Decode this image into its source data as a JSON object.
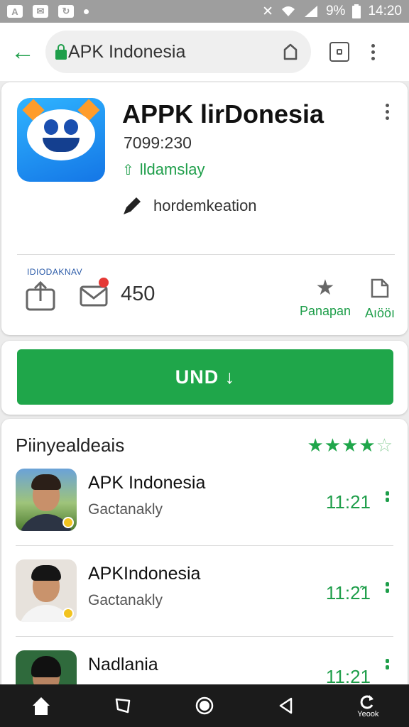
{
  "status_bar": {
    "battery_text": "9%",
    "time": "14:20"
  },
  "browser": {
    "url_text": "APK Indonesia"
  },
  "app": {
    "title": "APPK lirDonesia",
    "code": "7099:230",
    "developer": "lldamslay",
    "category": "hordemkeation",
    "icon_caption": "IDIODAKNAV",
    "downloads": "450",
    "rate_label": "Panapan",
    "add_label": "Aıööı",
    "install_label": "UND ↓"
  },
  "reviews": {
    "title": "Piinyealdeais",
    "stars_full": "★★★★",
    "stars_last": "☆",
    "items": [
      {
        "name": "APK Indonesia",
        "sub": "Gactanakly",
        "time": "11:21"
      },
      {
        "name": "APKIndonesia",
        "sub": "Gactanakly",
        "time": "11:2̃1"
      },
      {
        "name": "Nadlania",
        "sub": "",
        "time": "11:21"
      }
    ]
  },
  "nav": {
    "extra_label": "Yeook"
  },
  "colors": {
    "accent_green": "#1fa64a",
    "status_bar": "#9e9e9e",
    "nav_bar": "#1b1b1b"
  }
}
